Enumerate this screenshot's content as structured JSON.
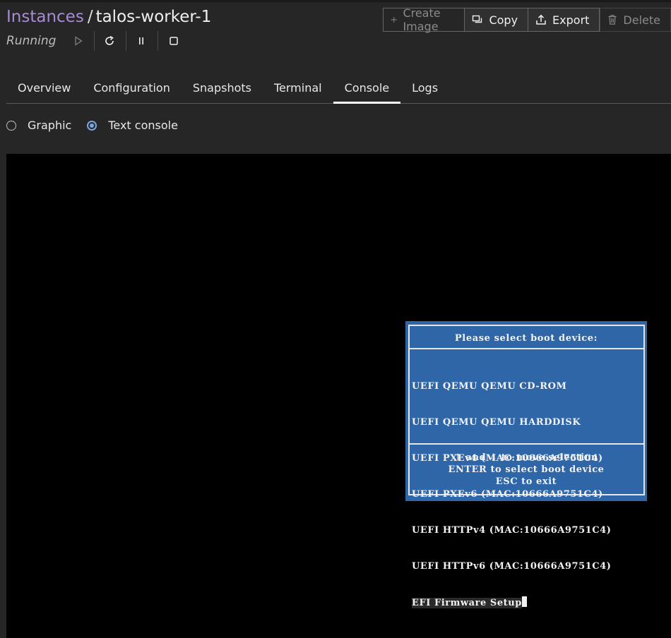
{
  "breadcrumb": {
    "parent": "Instances",
    "separator": "/",
    "current": "talos-worker-1"
  },
  "status": {
    "text": "Running",
    "controls": [
      "play-icon",
      "restart-icon",
      "pause-icon",
      "stop-icon"
    ]
  },
  "actions": {
    "create_image": "Create Image",
    "copy": "Copy",
    "export": "Export",
    "delete": "Delete"
  },
  "tabs": [
    {
      "label": "Overview",
      "active": false
    },
    {
      "label": "Configuration",
      "active": false
    },
    {
      "label": "Snapshots",
      "active": false
    },
    {
      "label": "Terminal",
      "active": false
    },
    {
      "label": "Console",
      "active": true
    },
    {
      "label": "Logs",
      "active": false
    }
  ],
  "console_mode": {
    "options": [
      {
        "label": "Graphic",
        "checked": false
      },
      {
        "label": "Text console",
        "checked": true
      }
    ]
  },
  "boot_menu": {
    "title": "Please select boot device:",
    "items": [
      "UEFI QEMU QEMU CD-ROM",
      "UEFI QEMU QEMU HARDDISK",
      "UEFI PXEv4 (MAC:10666A9751C4)",
      "UEFI PXEv6 (MAC:10666A9751C4)",
      "UEFI HTTPv4 (MAC:10666A9751C4)",
      "UEFI HTTPv6 (MAC:10666A9751C4)",
      "EFI Firmware Setup"
    ],
    "selected_index": 6,
    "help": [
      "↑ and ↓ to move selection",
      "ENTER to select boot device",
      "ESC to exit"
    ]
  },
  "colors": {
    "background": "#262626",
    "link": "#a88bd6",
    "radio_accent": "#7aa7e0",
    "boot_menu_bg": "#2f66a8",
    "console_bg": "#000000"
  }
}
